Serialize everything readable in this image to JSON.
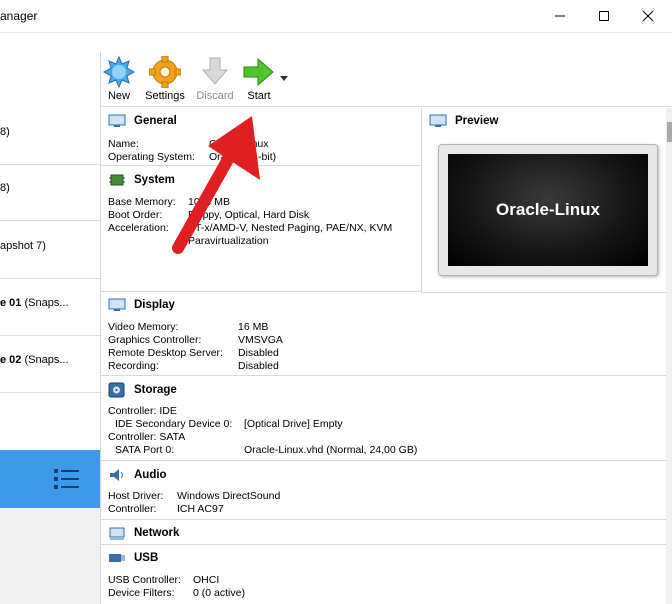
{
  "window": {
    "title": "anager",
    "minimize": "—",
    "maximize": "☐",
    "close": "✕"
  },
  "sidebar": {
    "items": [
      {
        "bold": "",
        "text": "8)"
      },
      {
        "bold": "",
        "text": "8)"
      },
      {
        "bold": "",
        "text": "apshot 7)"
      },
      {
        "bold": "e 01",
        "text": " (Snaps..."
      },
      {
        "bold": "e 02",
        "text": " (Snaps..."
      }
    ]
  },
  "toolbar": {
    "new_label": "New",
    "settings_label": "Settings",
    "discard_label": "Discard",
    "start_label": "Start"
  },
  "general": {
    "title": "General",
    "name_key": "Name:",
    "name_val": "Oracle-Linux",
    "os_key": "Operating System:",
    "os_val": "Oracle (64-bit)"
  },
  "system": {
    "title": "System",
    "mem_key": "Base Memory:",
    "mem_val": "1024 MB",
    "boot_key": "Boot Order:",
    "boot_val": "Floppy, Optical, Hard Disk",
    "accel_key": "Acceleration:",
    "accel_val": "VT-x/AMD-V, Nested Paging, PAE/NX, KVM",
    "accel_val2": "Paravirtualization"
  },
  "preview": {
    "title": "Preview",
    "screen_text": "Oracle-Linux"
  },
  "display": {
    "title": "Display",
    "vmem_key": "Video Memory:",
    "vmem_val": "16 MB",
    "gc_key": "Graphics Controller:",
    "gc_val": "VMSVGA",
    "rds_key": "Remote Desktop Server:",
    "rds_val": "Disabled",
    "rec_key": "Recording:",
    "rec_val": "Disabled"
  },
  "storage": {
    "title": "Storage",
    "ctrl_ide": "Controller: IDE",
    "ide_dev_key": "IDE Secondary Device 0:",
    "ide_dev_val": "[Optical Drive] Empty",
    "ctrl_sata": "Controller: SATA",
    "sata_key": "SATA Port 0:",
    "sata_val": "Oracle-Linux.vhd (Normal, 24,00 GB)"
  },
  "audio": {
    "title": "Audio",
    "host_key": "Host Driver:",
    "host_val": "Windows DirectSound",
    "ctrl_key": "Controller:",
    "ctrl_val": "ICH AC97"
  },
  "network": {
    "title": "Network"
  },
  "usb": {
    "title": "USB",
    "ctrl_key": "USB Controller:",
    "ctrl_val": "OHCI",
    "filters_key": "Device Filters:",
    "filters_val": "0 (0 active)"
  },
  "colors": {
    "selection": "#3d9ae8",
    "annotation_arrow": "#e02020"
  }
}
